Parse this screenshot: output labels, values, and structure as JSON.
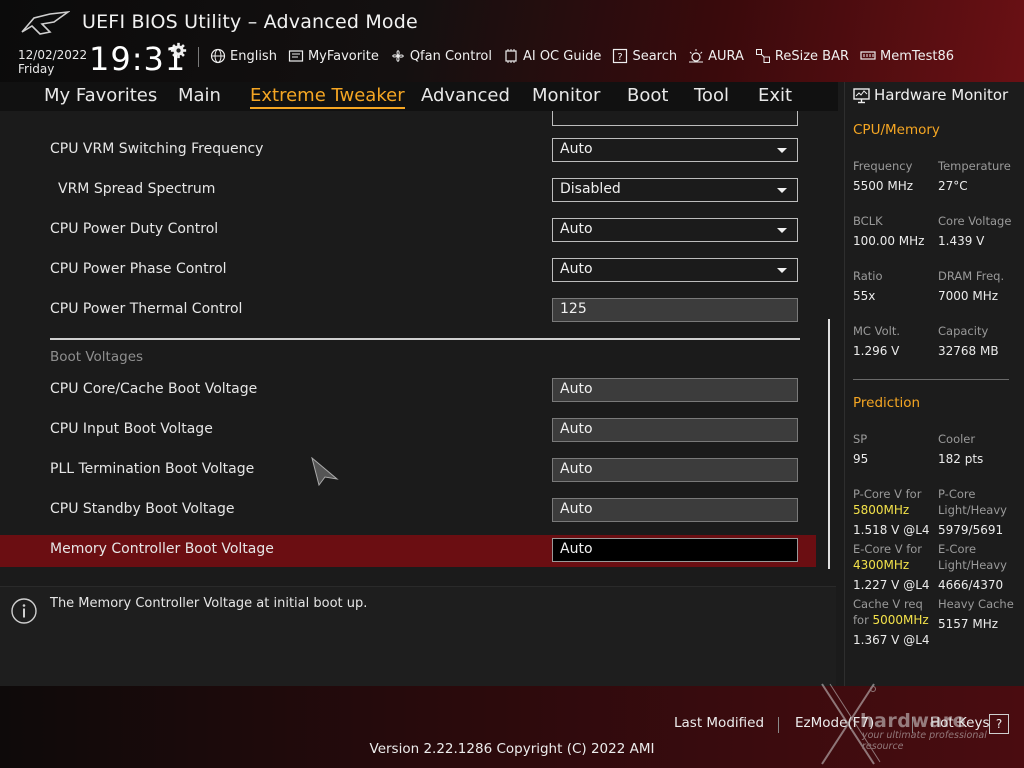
{
  "header": {
    "title": "UEFI BIOS Utility – Advanced Mode",
    "date": "12/02/2022",
    "day": "Friday",
    "time": "19:31",
    "tools": [
      {
        "label": "English",
        "icon": "globe-icon"
      },
      {
        "label": "MyFavorite",
        "icon": "favorite-icon"
      },
      {
        "label": "Qfan Control",
        "icon": "fan-icon"
      },
      {
        "label": "AI OC Guide",
        "icon": "ai-oc-icon"
      },
      {
        "label": "Search",
        "icon": "search-help-icon"
      },
      {
        "label": "AURA",
        "icon": "aura-icon"
      },
      {
        "label": "ReSize BAR",
        "icon": "resize-bar-icon"
      },
      {
        "label": "MemTest86",
        "icon": "memtest-icon"
      }
    ]
  },
  "menu": {
    "items": [
      "My Favorites",
      "Main",
      "Extreme Tweaker",
      "Advanced",
      "Monitor",
      "Boot",
      "Tool",
      "Exit"
    ],
    "active": "Extreme Tweaker"
  },
  "settings": {
    "rows": [
      {
        "label": "CPU VRM Switching Frequency",
        "value": "Auto"
      },
      {
        "label": "VRM Spread Spectrum",
        "value": "Disabled"
      },
      {
        "label": "CPU Power Duty Control",
        "value": "Auto"
      },
      {
        "label": "CPU Power Phase Control",
        "value": "Auto"
      },
      {
        "label": "CPU Power Thermal Control",
        "value": "125"
      }
    ],
    "group_label": "Boot Voltages",
    "boot_rows": [
      {
        "label": "CPU Core/Cache Boot Voltage",
        "value": "Auto"
      },
      {
        "label": "CPU Input Boot Voltage",
        "value": "Auto"
      },
      {
        "label": "PLL Termination Boot Voltage",
        "value": "Auto"
      },
      {
        "label": "CPU Standby Boot Voltage",
        "value": "Auto"
      },
      {
        "label": "Memory Controller Boot Voltage",
        "value": "Auto"
      }
    ]
  },
  "info": {
    "text": "The Memory Controller Voltage at initial boot up."
  },
  "hw": {
    "title": "Hardware Monitor",
    "cpu_memory": {
      "title": "CPU/Memory",
      "items": [
        {
          "label": "Frequency",
          "value": "5500 MHz"
        },
        {
          "label": "Temperature",
          "value": "27°C"
        },
        {
          "label": "BCLK",
          "value": "100.00 MHz"
        },
        {
          "label": "Core Voltage",
          "value": "1.439 V"
        },
        {
          "label": "Ratio",
          "value": "55x"
        },
        {
          "label": "DRAM Freq.",
          "value": "7000 MHz"
        },
        {
          "label": "MC Volt.",
          "value": "1.296 V"
        },
        {
          "label": "Capacity",
          "value": "32768 MB"
        }
      ]
    },
    "prediction": {
      "title": "Prediction",
      "sp_label": "SP",
      "sp_value": "95",
      "cooler_label": "Cooler",
      "cooler_value": "182 pts",
      "pcore_v_label": "P-Core V for",
      "pcore_v_freq": "5800MHz",
      "pcore_v_value": "1.518 V @L4",
      "pcore_lh_label1": "P-Core",
      "pcore_lh_label2": "Light/Heavy",
      "pcore_lh_value": "5979/5691",
      "ecore_v_label": "E-Core V for",
      "ecore_v_freq": "4300MHz",
      "ecore_v_value": "1.227 V @L4",
      "ecore_lh_label1": "E-Core",
      "ecore_lh_label2": "Light/Heavy",
      "ecore_lh_value": "4666/4370",
      "cache_v_label1": "Cache V req",
      "cache_v_label2": "for",
      "cache_v_freq": "5000MHz",
      "cache_v_value": "1.367 V @L4",
      "heavy_cache_label": "Heavy Cache",
      "heavy_cache_value": "5157 MHz"
    }
  },
  "footer": {
    "last_modified": "Last Modified",
    "ez_mode": "EzMode(F7)",
    "hot_keys": "Hot Keys",
    "hot_keys_key": "?",
    "version": "Version 2.22.1286 Copyright (C) 2022 AMI"
  },
  "watermark": {
    "text": "hardware",
    "subtitle": "your ultimate professional resource"
  }
}
